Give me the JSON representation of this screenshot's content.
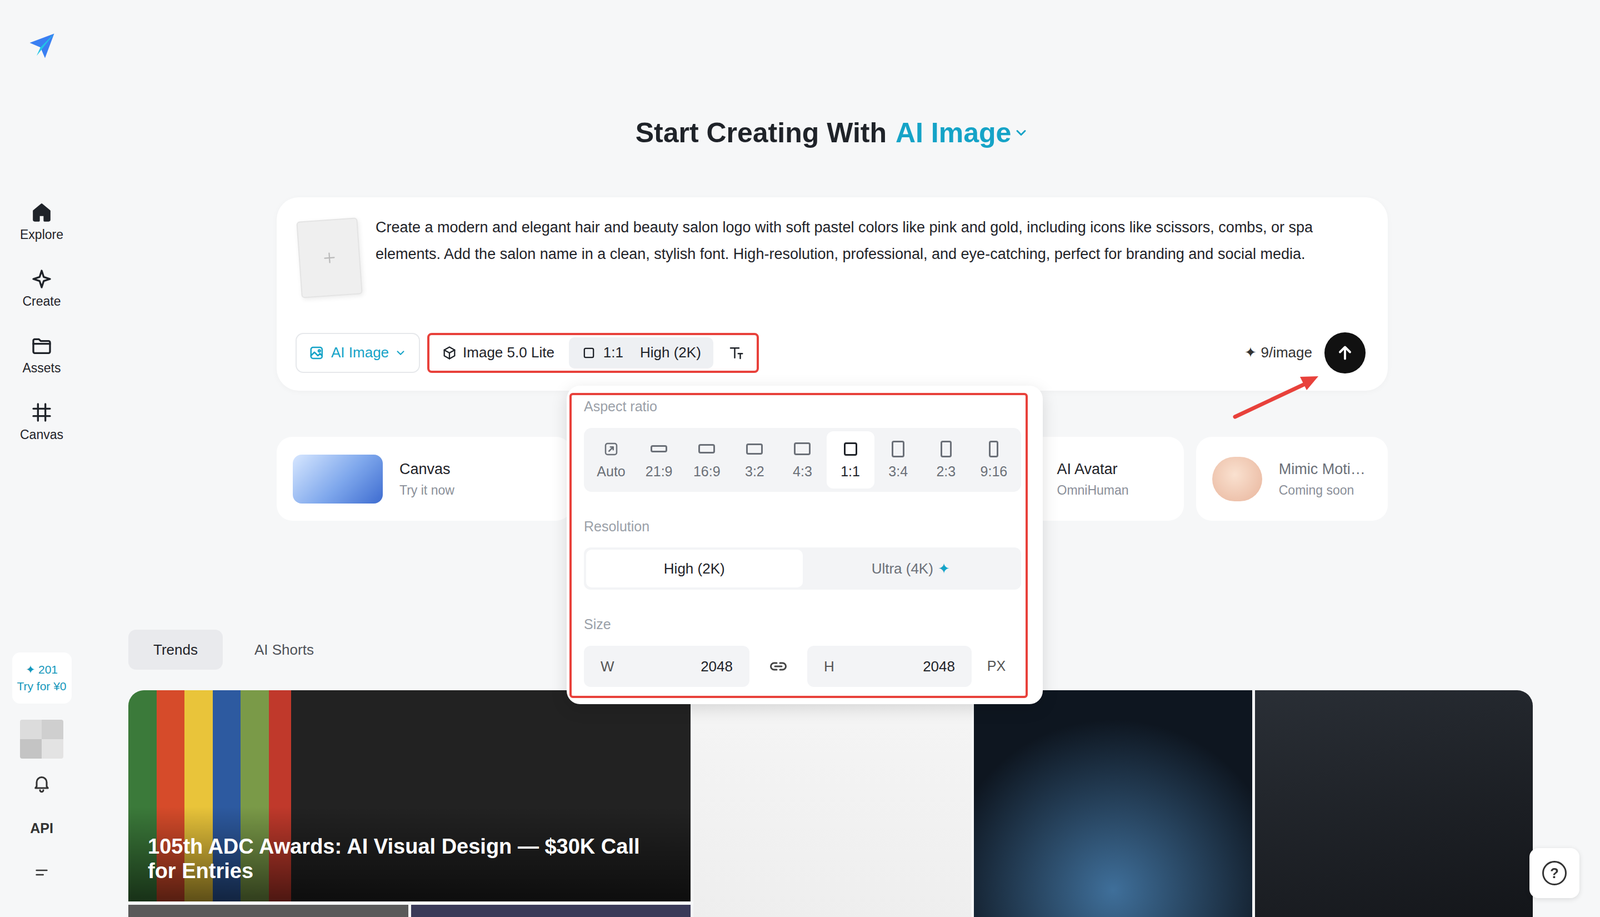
{
  "sidebar": {
    "items": [
      {
        "label": "Explore",
        "selected": true
      },
      {
        "label": "Create",
        "selected": false
      },
      {
        "label": "Assets",
        "selected": false
      },
      {
        "label": "Canvas",
        "selected": false
      }
    ],
    "credits": {
      "icon": "✦",
      "count": "201",
      "offer": "Try for ¥0"
    },
    "api": "API"
  },
  "header": {
    "title": "Start Creating With",
    "mode": "AI Image"
  },
  "prompt": {
    "text": "Create a modern and elegant hair and beauty salon logo with soft pastel colors like pink and gold, including icons like scissors, combs, or spa elements. Add the salon name in a clean, stylish font. High-resolution, professional, and eye-catching, perfect for branding and social media.",
    "mode_button": "AI Image",
    "model": "Image 5.0 Lite",
    "ratio": "1:1",
    "resolution": "High (2K)",
    "cost_icon": "✦",
    "cost": "9/image"
  },
  "settings": {
    "aspect_title": "Aspect ratio",
    "ratios": [
      {
        "label": "Auto",
        "kind": "auto",
        "selected": false
      },
      {
        "label": "21:9",
        "kind": "ratio",
        "selected": false
      },
      {
        "label": "16:9",
        "kind": "ratio",
        "selected": false
      },
      {
        "label": "3:2",
        "kind": "ratio",
        "selected": false
      },
      {
        "label": "4:3",
        "kind": "ratio",
        "selected": false
      },
      {
        "label": "1:1",
        "kind": "ratio",
        "selected": true
      },
      {
        "label": "3:4",
        "kind": "ratio",
        "selected": false
      },
      {
        "label": "2:3",
        "kind": "ratio",
        "selected": false
      },
      {
        "label": "9:16",
        "kind": "ratio",
        "selected": false
      }
    ],
    "resolution_title": "Resolution",
    "resolutions": [
      {
        "label": "High (2K)",
        "premium": false,
        "selected": true
      },
      {
        "label": "Ultra (4K)",
        "premium": true,
        "selected": false
      }
    ],
    "premium_icon": "✦",
    "size_title": "Size",
    "width_label": "W",
    "width": "2048",
    "height_label": "H",
    "height": "2048",
    "unit": "PX"
  },
  "features": [
    {
      "title": "Canvas",
      "subtitle": "Try it now",
      "disabled": false
    },
    {
      "title": "AI Avatar",
      "subtitle": "OmniHuman",
      "disabled": false
    },
    {
      "title": "Mimic Moti…",
      "subtitle": "Coming soon",
      "disabled": true
    }
  ],
  "tabs": [
    {
      "label": "Trends",
      "selected": true
    },
    {
      "label": "AI Shorts",
      "selected": false
    }
  ],
  "gallery": {
    "caption": "105th ADC Awards: AI Visual Design — $30K Call for Entries"
  },
  "help": "?"
}
